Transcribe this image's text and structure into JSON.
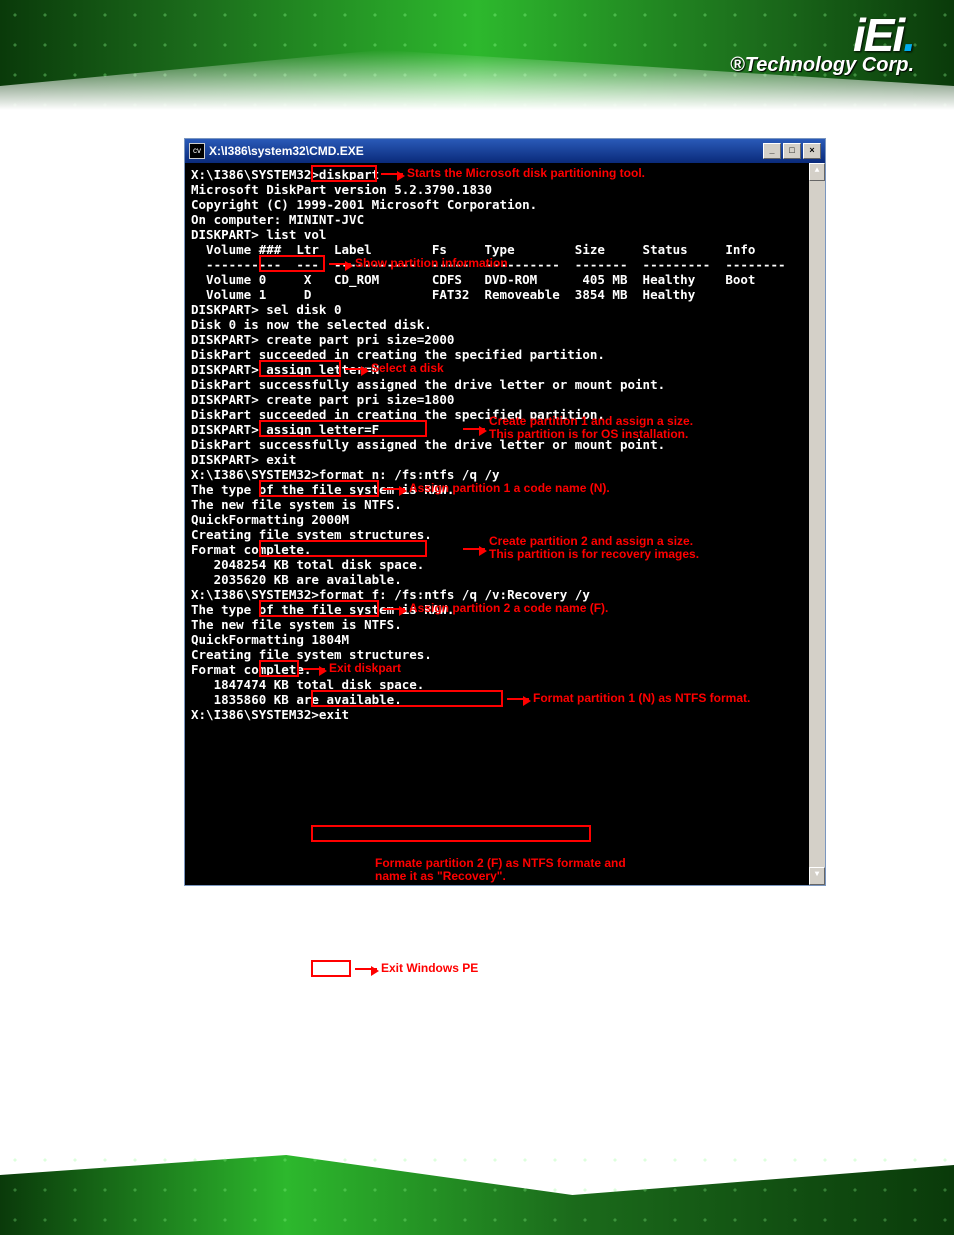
{
  "brand": {
    "logo_text": "iEi",
    "tagline": "®Technology Corp."
  },
  "window": {
    "title": "X:\\I386\\system32\\CMD.EXE",
    "icon_label": "cv"
  },
  "terminal": {
    "l1": "X:\\I386\\SYSTEM32>diskpart",
    "l2": "",
    "l3": "Microsoft DiskPart version 5.2.3790.1830",
    "l4": "Copyright (C) 1999-2001 Microsoft Corporation.",
    "l5": "On computer: MININT-JVC",
    "l6": "",
    "l7": "DISKPART> list vol",
    "l8": "",
    "l9": "  Volume ###  Ltr  Label        Fs     Type        Size     Status     Info",
    "l10": "  ----------  ---  -----------  -----  ----------  -------  ---------  --------",
    "l11": "  Volume 0     X   CD_ROM       CDFS   DVD-ROM      405 MB  Healthy    Boot",
    "l12": "  Volume 1     D                FAT32  Removeable  3854 MB  Healthy",
    "l13": "",
    "l14": "DISKPART> sel disk 0",
    "l15": "",
    "l16": "Disk 0 is now the selected disk.",
    "l17": "",
    "l18": "DISKPART> create part pri size=2000",
    "l19": "",
    "l20": "DiskPart succeeded in creating the specified partition.",
    "l21": "",
    "l22": "DISKPART> assign letter=N",
    "l23": "",
    "l24": "DiskPart successfully assigned the drive letter or mount point.",
    "l25": "",
    "l26": "DISKPART> create part pri size=1800",
    "l27": "",
    "l28": "DiskPart succeeded in creating the specified partition.",
    "l29": "",
    "l30": "DISKPART> assign letter=F",
    "l31": "",
    "l32": "DiskPart successfully assigned the drive letter or mount point.",
    "l33": "",
    "l34": "DISKPART> exit",
    "l35": "",
    "l36": "X:\\I386\\SYSTEM32>format n: /fs:ntfs /q /y",
    "l37": "The type of the file system is RAW.",
    "l38": "The new file system is NTFS.",
    "l39": "QuickFormatting 2000M",
    "l40": "Creating file system structures.",
    "l41": "Format complete.",
    "l42": "   2048254 KB total disk space.",
    "l43": "   2035620 KB are available.",
    "l44": "",
    "l45": "X:\\I386\\SYSTEM32>format f: /fs:ntfs /q /v:Recovery /y",
    "l46": "The type of the file system is RAW.",
    "l47": "The new file system is NTFS.",
    "l48": "QuickFormatting 1804M",
    "l49": "Creating file system structures.",
    "l50": "Format complete.",
    "l51": "   1847474 KB total disk space.",
    "l52": "   1835860 KB are available.",
    "l53": "",
    "l54": "X:\\I386\\SYSTEM32>exit"
  },
  "annotations": {
    "diskpart": "Starts the Microsoft disk partitioning tool.",
    "listvol": "Show partition information",
    "seldisk": "Select a disk",
    "create1a": "Create partition 1 and assign a size.",
    "create1b": "This partition is for OS installation.",
    "assign1": "Assign partition 1 a code name (N).",
    "create2a": "Create partition 2 and assign a size.",
    "create2b": "This partition is for recovery images.",
    "assign2": "Assign partition 2 a code name (F).",
    "exit1": "Exit diskpart",
    "format1": "Format partition 1 (N) as NTFS format.",
    "format2a": "Formate partition 2 (F) as NTFS formate and",
    "format2b": "name it as \"Recovery\".",
    "exit2": "Exit Windows PE"
  }
}
